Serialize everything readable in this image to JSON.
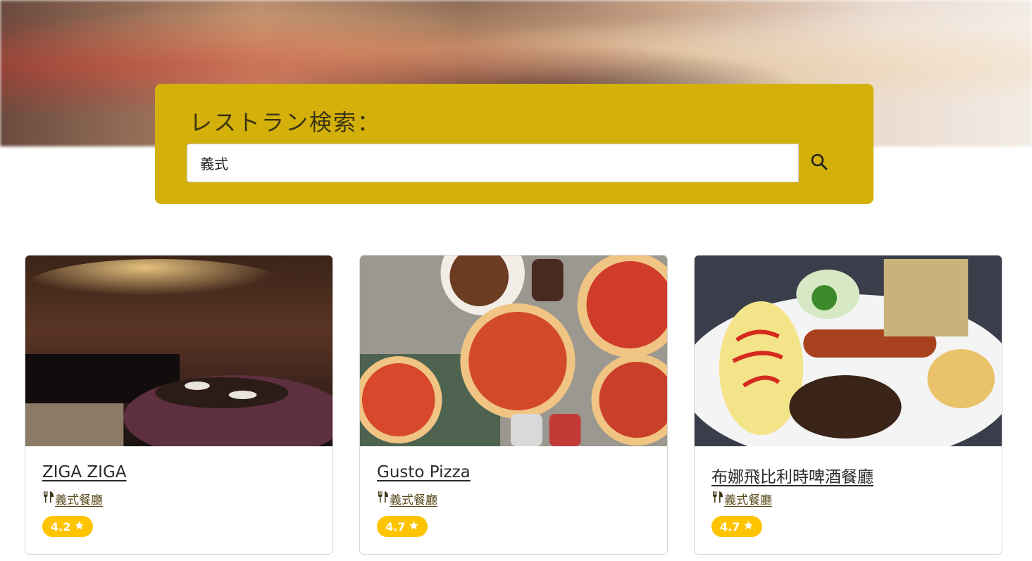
{
  "search": {
    "title": "レストラン検索：",
    "query": "義式",
    "button_icon": "search-icon"
  },
  "colors": {
    "panel": "#d4b10a",
    "rating_badge": "#ffc400"
  },
  "restaurants": [
    {
      "name": "ZIGA ZIGA",
      "category": "義式餐廳",
      "category_icon": "utensils-icon",
      "rating": "4.2",
      "rating_icon": "star-icon"
    },
    {
      "name": "Gusto Pizza",
      "category": "義式餐廳",
      "category_icon": "utensils-icon",
      "rating": "4.7",
      "rating_icon": "star-icon"
    },
    {
      "name": "布娜飛比利時啤酒餐廳",
      "category": "義式餐廳",
      "category_icon": "utensils-icon",
      "rating": "4.7",
      "rating_icon": "star-icon"
    }
  ]
}
